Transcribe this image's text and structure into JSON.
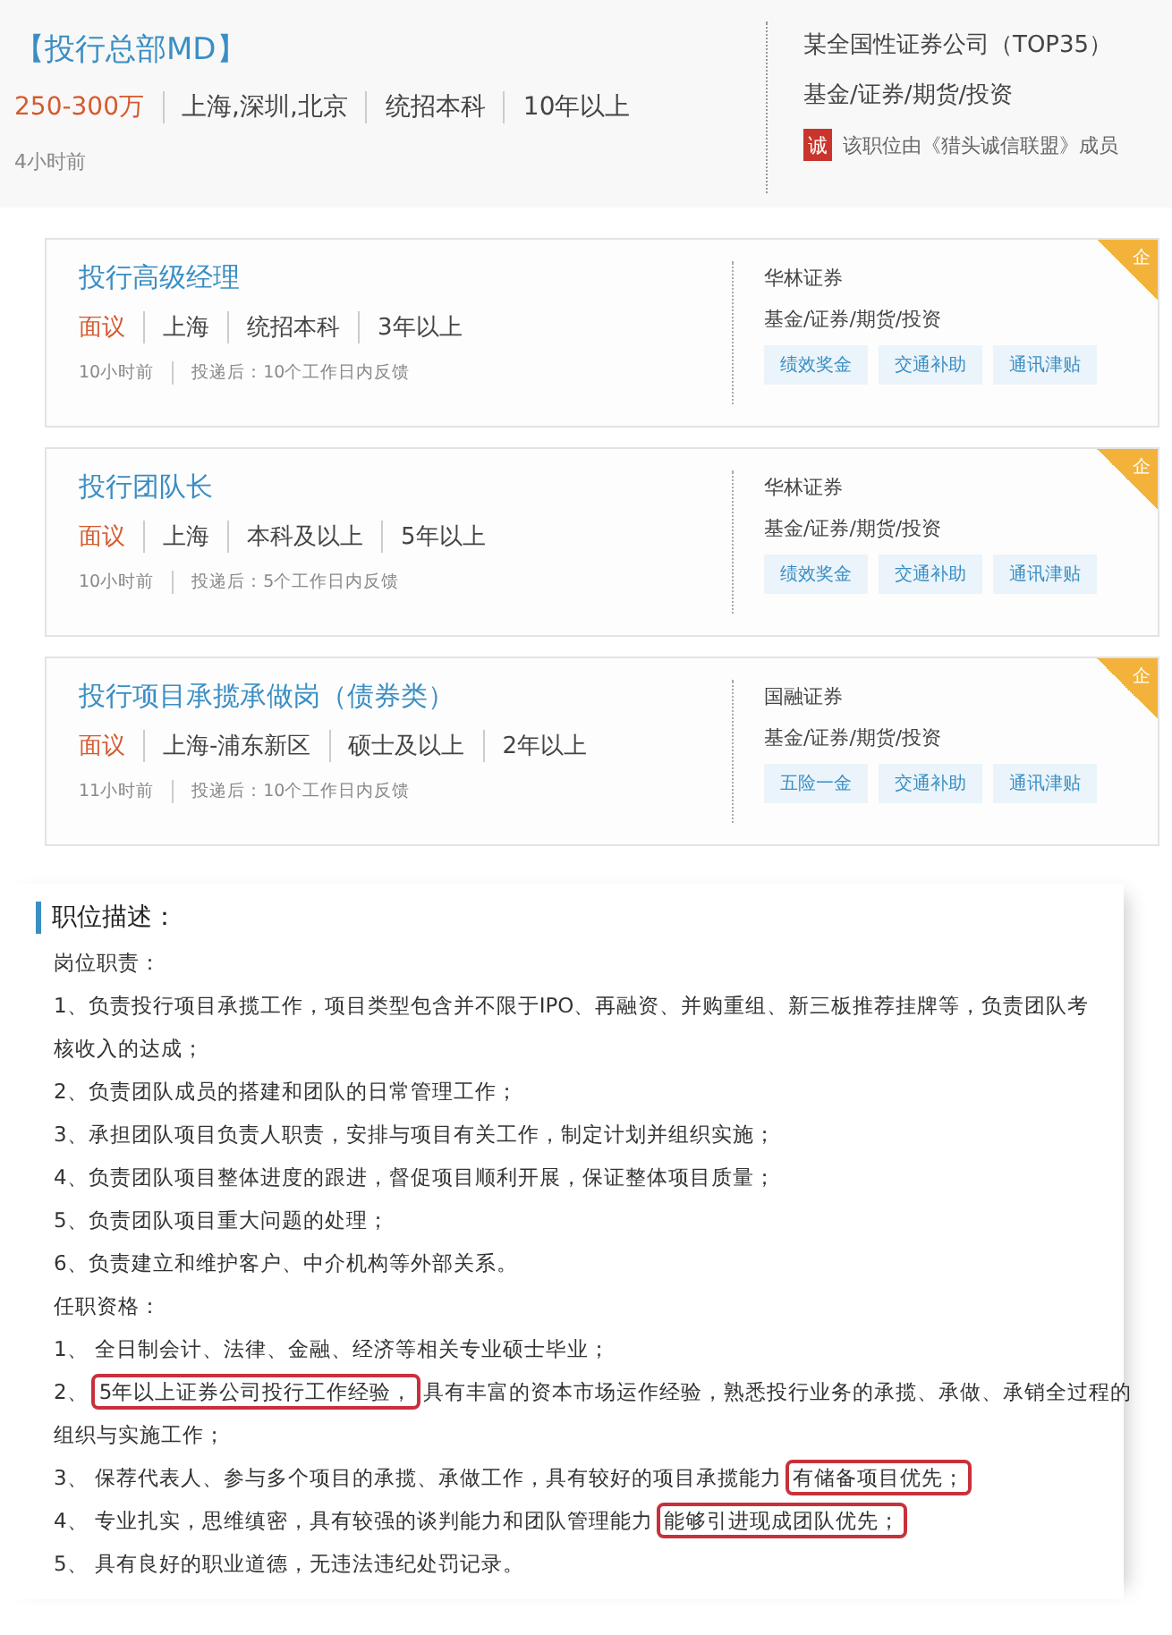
{
  "header": {
    "title": "【投行总部MD】",
    "salary": "250-300万",
    "tags": [
      "上海,深圳,北京",
      "统招本科",
      "10年以上"
    ],
    "posted": "4小时前",
    "company": "某全国性证券公司（TOP35）",
    "industry": "基金/证券/期货/投资",
    "badge_icon_text": "诚",
    "badge_text": "该职位由《猎头诚信联盟》成员"
  },
  "jobs": [
    {
      "title": "投行高级经理",
      "salary": "面议",
      "tags": [
        "上海",
        "统招本科",
        "3年以上"
      ],
      "posted": "10小时前",
      "feedback": "投递后：10个工作日内反馈",
      "company": "华林证券",
      "industry": "基金/证券/期货/投资",
      "benefits": [
        "绩效奖金",
        "交通补助",
        "通讯津贴"
      ],
      "corner": "企"
    },
    {
      "title": "投行团队长",
      "salary": "面议",
      "tags": [
        "上海",
        "本科及以上",
        "5年以上"
      ],
      "posted": "10小时前",
      "feedback": "投递后：5个工作日内反馈",
      "company": "华林证券",
      "industry": "基金/证券/期货/投资",
      "benefits": [
        "绩效奖金",
        "交通补助",
        "通讯津贴"
      ],
      "corner": "企"
    },
    {
      "title": "投行项目承揽承做岗（债券类）",
      "salary": "面议",
      "tags": [
        "上海-浦东新区",
        "硕士及以上",
        "2年以上"
      ],
      "posted": "11小时前",
      "feedback": "投递后：10个工作日内反馈",
      "company": "国融证券",
      "industry": "基金/证券/期货/投资",
      "benefits": [
        "五险一金",
        "交通补助",
        "通讯津贴"
      ],
      "corner": "企"
    }
  ],
  "description": {
    "heading": "职位描述：",
    "sections": [
      {
        "heading": "岗位职责：",
        "items": [
          [
            {
              "text": "1、负责投行项目承揽工作，项目类型包含并不限于IPO、再融资、并购重组、新三板推荐挂牌等，负责团队考核收入的达成；",
              "circled": false
            }
          ],
          [
            {
              "text": "2、负责团队成员的搭建和团队的日常管理工作；",
              "circled": false
            }
          ],
          [
            {
              "text": "3、承担团队项目负责人职责，安排与项目有关工作，制定计划并组织实施；",
              "circled": false
            }
          ],
          [
            {
              "text": "4、负责团队项目整体进度的跟进，督促项目顺利开展，保证整体项目质量；",
              "circled": false
            }
          ],
          [
            {
              "text": "5、负责团队项目重大问题的处理；",
              "circled": false
            }
          ],
          [
            {
              "text": "6、负责建立和维护客户、中介机构等外部关系。",
              "circled": false
            }
          ]
        ]
      },
      {
        "heading": "任职资格：",
        "items": [
          [
            {
              "text": "1、 全日制会计、法律、金融、经济等相关专业硕士毕业；",
              "circled": false
            }
          ],
          [
            {
              "text": "2、",
              "circled": false
            },
            {
              "text": "5年以上证券公司投行工作经验，",
              "circled": true
            },
            {
              "text": "具有丰富的资本市场运作经验，熟悉投行业务的承揽、承做、承销全过程的",
              "circled": false
            }
          ],
          [
            {
              "text": "组织与实施工作；",
              "circled": false
            }
          ],
          [
            {
              "text": "3、 保荐代表人、参与多个项目的承揽、承做工作，具有较好的项目承揽能力",
              "circled": false
            },
            {
              "text": "有储备项目优先；",
              "circled": true
            }
          ],
          [
            {
              "text": "4、 专业扎实，思维缜密，具有较强的谈判能力和团队管理能力",
              "circled": false
            },
            {
              "text": "能够引进现成团队优先；",
              "circled": true
            }
          ],
          [
            {
              "text": "5、 具有良好的职业道德，无违法违纪处罚记录。",
              "circled": false
            }
          ]
        ]
      }
    ]
  }
}
